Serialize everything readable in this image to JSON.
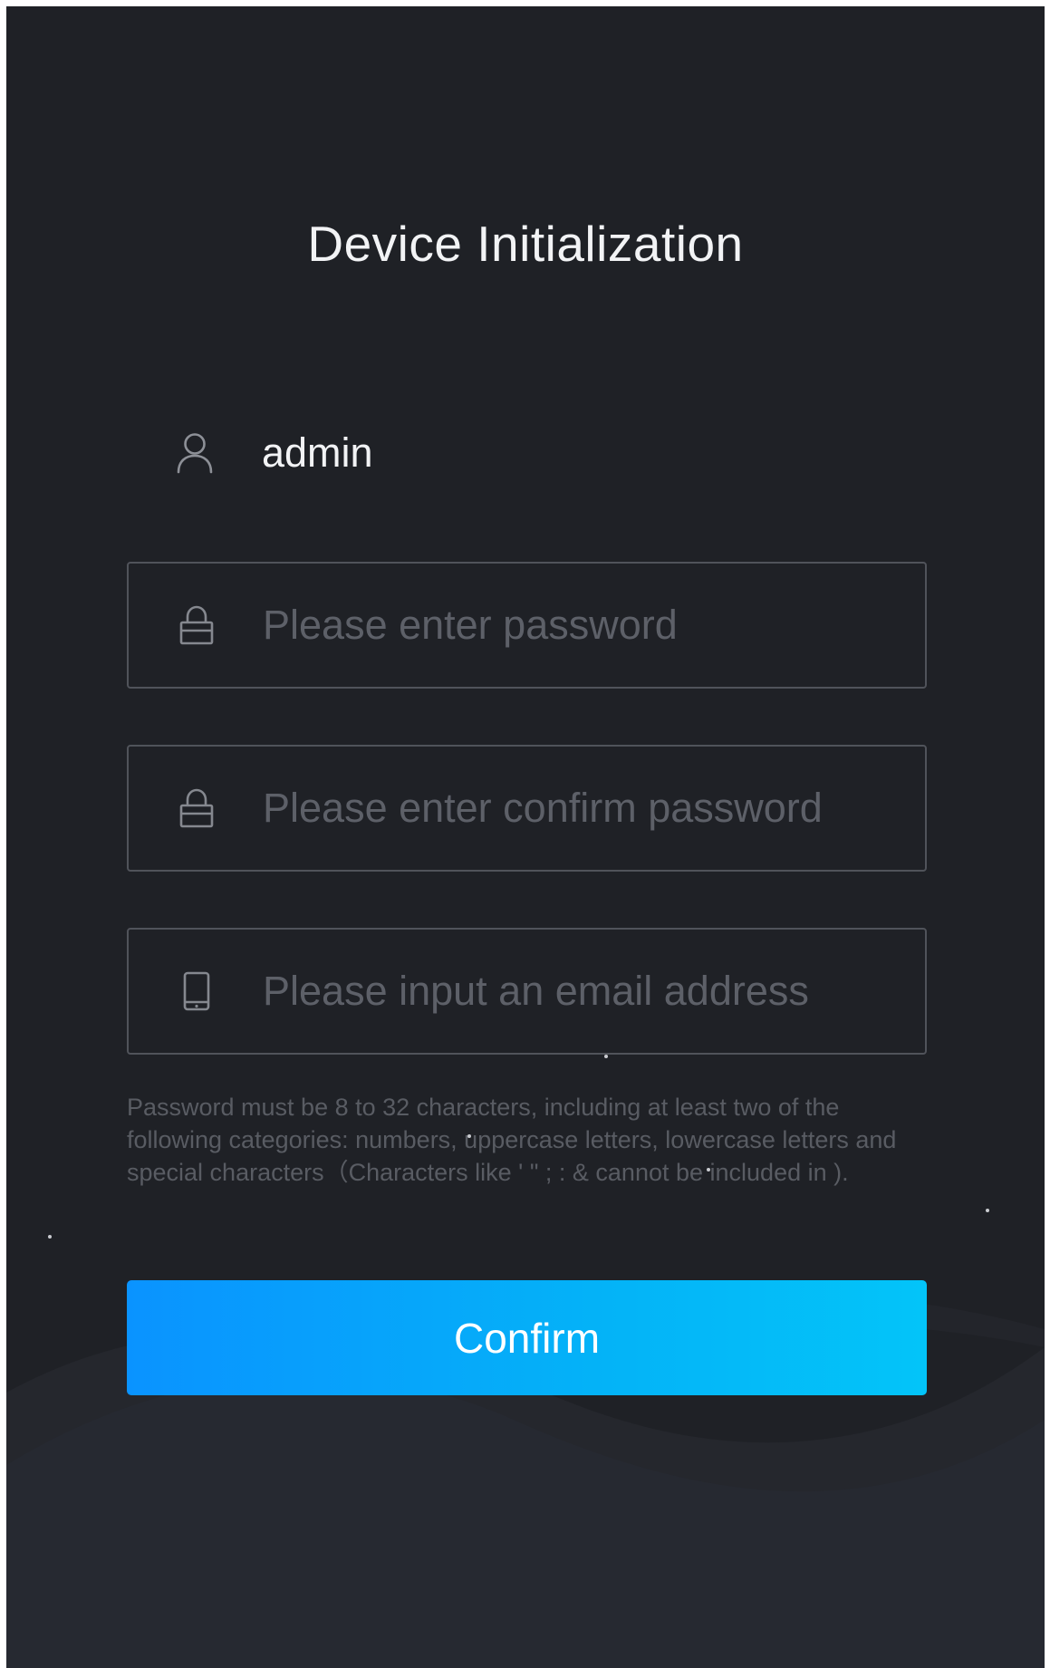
{
  "page": {
    "title": "Device Initialization"
  },
  "user": {
    "icon": "user-icon",
    "username": "admin"
  },
  "fields": {
    "password": {
      "icon": "lock-icon",
      "placeholder": "Please enter password",
      "value": ""
    },
    "confirm_password": {
      "icon": "lock-icon",
      "placeholder": "Please enter confirm password",
      "value": ""
    },
    "email": {
      "icon": "phone-icon",
      "placeholder": "Please input an email address",
      "value": ""
    }
  },
  "hint": "Password must be 8 to 32 characters, including at least two of the following categories: numbers, uppercase letters, lowercase letters and special characters（Characters like ' \" ; : & cannot be included in ).",
  "confirm_label": "Confirm",
  "colors": {
    "background": "#1f2126",
    "field_border": "#50535a",
    "placeholder": "#5d6068",
    "accent_start": "#0a93ff",
    "accent_end": "#03c4f9",
    "text": "#f2f3f5"
  }
}
